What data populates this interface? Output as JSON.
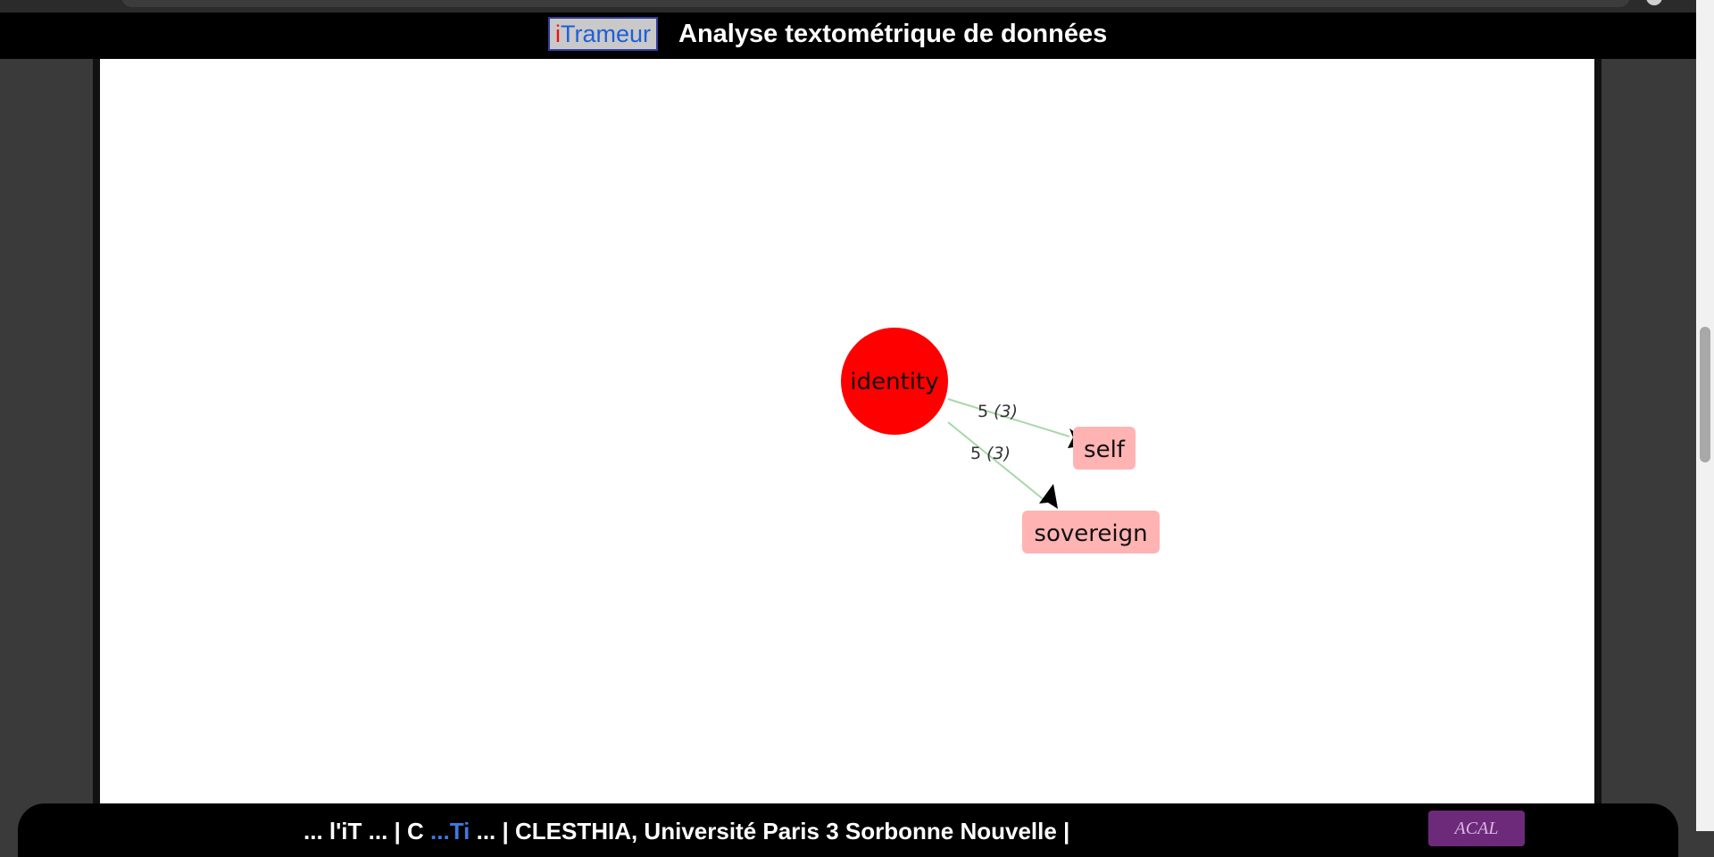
{
  "header": {
    "brand_i": "i",
    "brand_rest": "Trameur",
    "title": "Analyse textométrique de données"
  },
  "graph": {
    "center_node": {
      "label": "identity",
      "color": "#ff0000"
    },
    "target_nodes": [
      {
        "label": "self",
        "color": "#ffb3b3"
      },
      {
        "label": "sovereign",
        "color": "#ffb3b3"
      }
    ],
    "edges": [
      {
        "from": "identity",
        "to": "self",
        "freq": "5",
        "docs": "(3)"
      },
      {
        "from": "identity",
        "to": "sovereign",
        "freq": "5",
        "docs": "(3)"
      }
    ],
    "edge_color": "#a8d8a8"
  },
  "footer": {
    "part1": "... l'iT",
    "part2": "... | C",
    "link": "...Ti",
    "part3": "... | CLESTHIA, Université Paris 3 Sorbonne Nouvelle |",
    "logo_text": "ACAL"
  },
  "colors": {
    "header_bg": "#000000",
    "brand_i": "#ee1111",
    "brand_rest": "#1f5fd8",
    "page_bg": "#3a3a3a"
  }
}
